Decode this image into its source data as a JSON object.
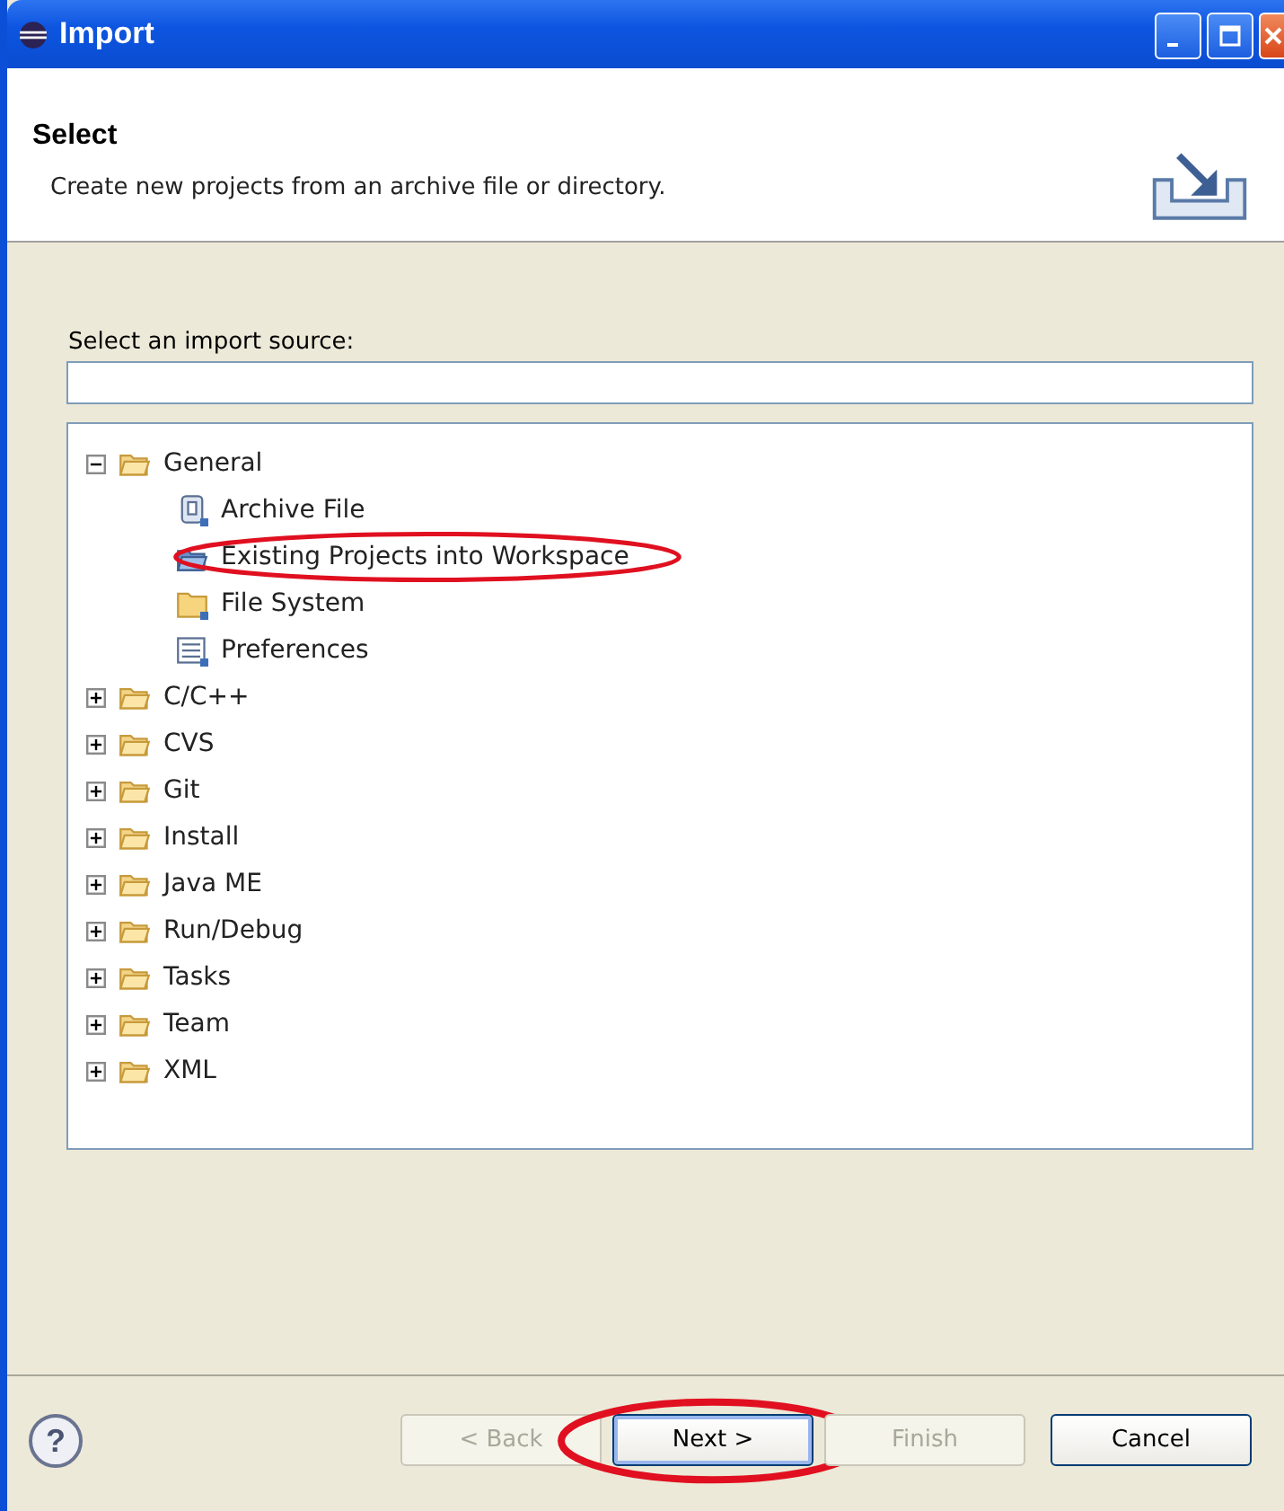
{
  "window": {
    "title": "Import"
  },
  "header": {
    "title": "Select",
    "description": "Create new projects from an archive file or directory."
  },
  "filter": {
    "label": "Select an import source:"
  },
  "help": {
    "label": "?"
  },
  "tree": [
    {
      "label": "General",
      "kind": "folder",
      "expanded": true,
      "circled": false,
      "children": [
        {
          "label": "Archive File",
          "kind": "archive",
          "circled": false
        },
        {
          "label": "Existing Projects into Workspace",
          "kind": "project",
          "circled": true
        },
        {
          "label": "File System",
          "kind": "plainfolder",
          "circled": false
        },
        {
          "label": "Preferences",
          "kind": "prefs",
          "circled": false
        }
      ]
    },
    {
      "label": "C/C++",
      "kind": "folder",
      "expanded": false,
      "circled": false
    },
    {
      "label": "CVS",
      "kind": "folder",
      "expanded": false,
      "circled": false
    },
    {
      "label": "Git",
      "kind": "folder",
      "expanded": false,
      "circled": false
    },
    {
      "label": "Install",
      "kind": "folder",
      "expanded": false,
      "circled": false
    },
    {
      "label": "Java ME",
      "kind": "folder",
      "expanded": false,
      "circled": false
    },
    {
      "label": "Run/Debug",
      "kind": "folder",
      "expanded": false,
      "circled": false
    },
    {
      "label": "Tasks",
      "kind": "folder",
      "expanded": false,
      "circled": false
    },
    {
      "label": "Team",
      "kind": "folder",
      "expanded": false,
      "circled": false
    },
    {
      "label": "XML",
      "kind": "folder",
      "expanded": false,
      "circled": false
    }
  ],
  "buttons": [
    {
      "label": "< Back",
      "disabled": true,
      "default": false,
      "circled": false
    },
    {
      "label": "Next >",
      "disabled": false,
      "default": true,
      "circled": true
    },
    {
      "label": "Finish",
      "disabled": true,
      "default": false,
      "circled": false
    },
    {
      "label": "Cancel",
      "disabled": false,
      "default": false,
      "circled": false
    }
  ]
}
